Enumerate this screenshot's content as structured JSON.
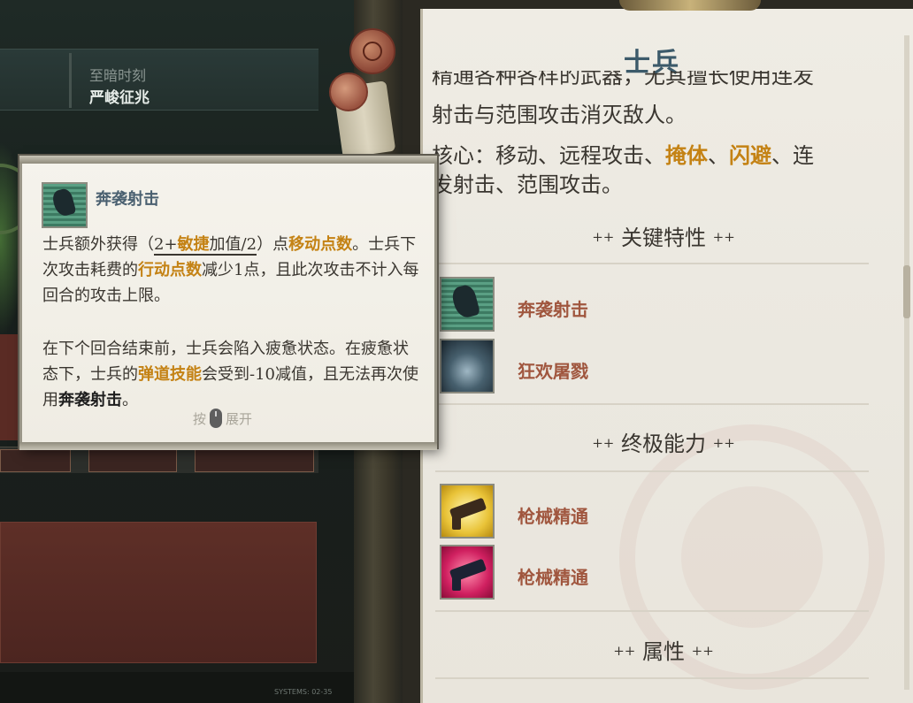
{
  "left_ui": {
    "top_panel": {
      "subtitle": "至暗时刻",
      "title": "严峻征兆"
    },
    "system_text": "SYSTEMS: 02-35"
  },
  "tooltip": {
    "icon": "charge-shot-icon",
    "title": "奔袭射击",
    "para1": {
      "t1": "士兵额外获得（",
      "t2": "2+",
      "t3": "敏捷",
      "t4": "加值/2",
      "t5": "）点",
      "t6": "移动点数",
      "t7": "。士兵下次攻击耗费的",
      "t8": "行动点数",
      "t9": "减少1点，且此次攻击不计入每回合的攻击上限。"
    },
    "para2": {
      "t1": "在下个回合结束前，士兵会陷入疲惫状态。在疲惫状态下，士兵的",
      "t2": "弹道技能",
      "t3": "会受到-10减值，且无法再次使用",
      "t4": "奔袭射击",
      "t5": "。"
    },
    "hint": {
      "press": "按",
      "expand": "展开"
    }
  },
  "panel": {
    "title": "士兵",
    "desc_cut": "精通各种各样的武器，无其擅长使用连发",
    "desc_line2": "射击与范围攻击消灭敌人。",
    "core": {
      "t1": "核心：移动、远程攻击、",
      "t2": "掩体",
      "t3": "、",
      "t4": "闪避",
      "t5": "、连",
      "t6": "发射击、范围攻击。"
    },
    "sections": {
      "key_traits": "关键特性",
      "ultimate": "终极能力",
      "attributes": "属性",
      "plus": "++"
    },
    "key_traits": [
      {
        "label": "奔袭射击",
        "icon": "charge-shot-icon"
      },
      {
        "label": "狂欢屠戮",
        "icon": "frenzy-slaughter-icon"
      }
    ],
    "ultimates": [
      {
        "label": "枪械精通",
        "icon": "weapon-mastery-icon"
      },
      {
        "label": "枪械精通",
        "icon": "weapon-mastery-icon"
      }
    ]
  },
  "colors": {
    "highlight": "#c48214",
    "skill_label": "#a0563e",
    "title": "#3c5a6a"
  }
}
